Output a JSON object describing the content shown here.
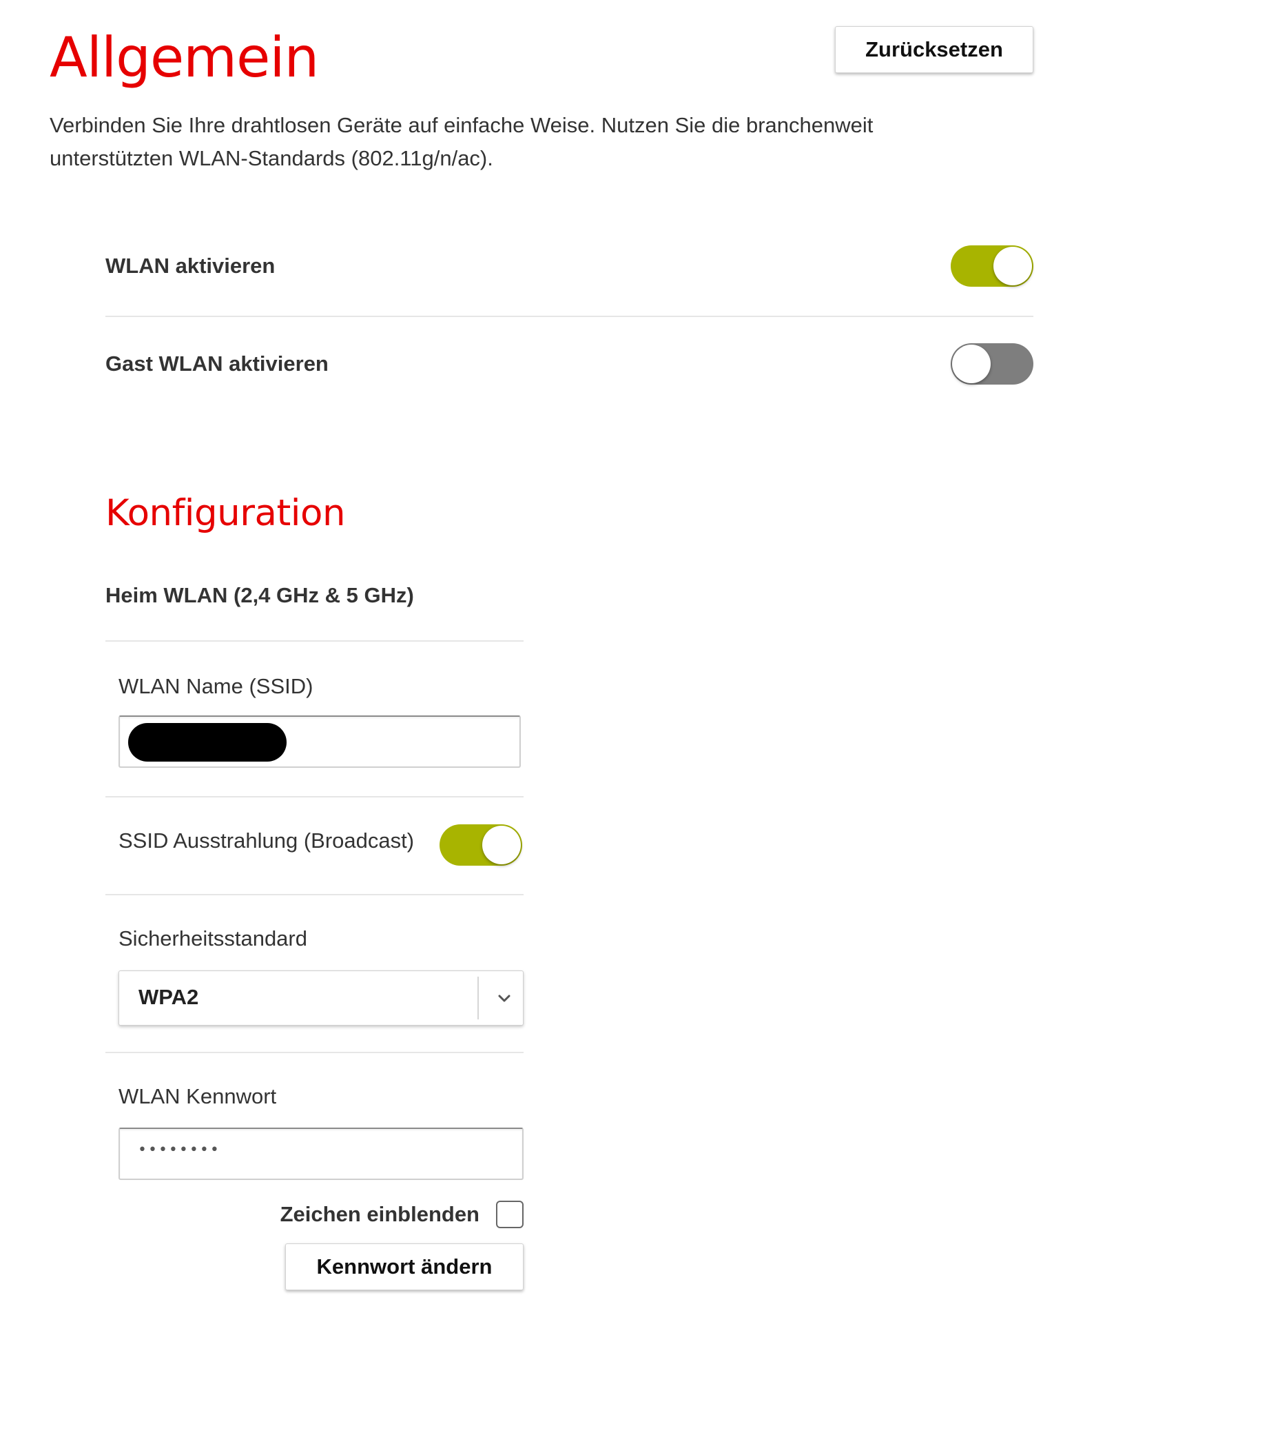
{
  "header": {
    "title": "Allgemein",
    "reset_label": "Zurücksetzen",
    "intro_line1": "Verbinden Sie Ihre drahtlosen Geräte auf einfache Weise. Nutzen Sie die branchenweit",
    "intro_line2": "unterstützten WLAN-Standards (802.11g/n/ac)."
  },
  "general": {
    "wlan_enable": {
      "label": "WLAN aktivieren",
      "on": true
    },
    "guest_wlan_enable": {
      "label": "Gast WLAN aktivieren",
      "on": false
    }
  },
  "config": {
    "title": "Konfiguration",
    "network_title": "Heim WLAN (2,4 GHz & 5 GHz)",
    "ssid_label": "WLAN Name (SSID)",
    "ssid_value": "",
    "broadcast": {
      "label": "SSID Ausstrahlung (Broadcast)",
      "on": true
    },
    "security_label": "Sicherheitsstandard",
    "security_value": "WPA2",
    "password_label": "WLAN Kennwort",
    "password_value": "••••••••",
    "show_chars_label": "Zeichen einblenden",
    "show_chars_checked": false,
    "change_password_label": "Kennwort ändern"
  },
  "colors": {
    "accent_red": "#e60000",
    "toggle_on": "#a8b400",
    "toggle_off": "#7e7e7e"
  }
}
